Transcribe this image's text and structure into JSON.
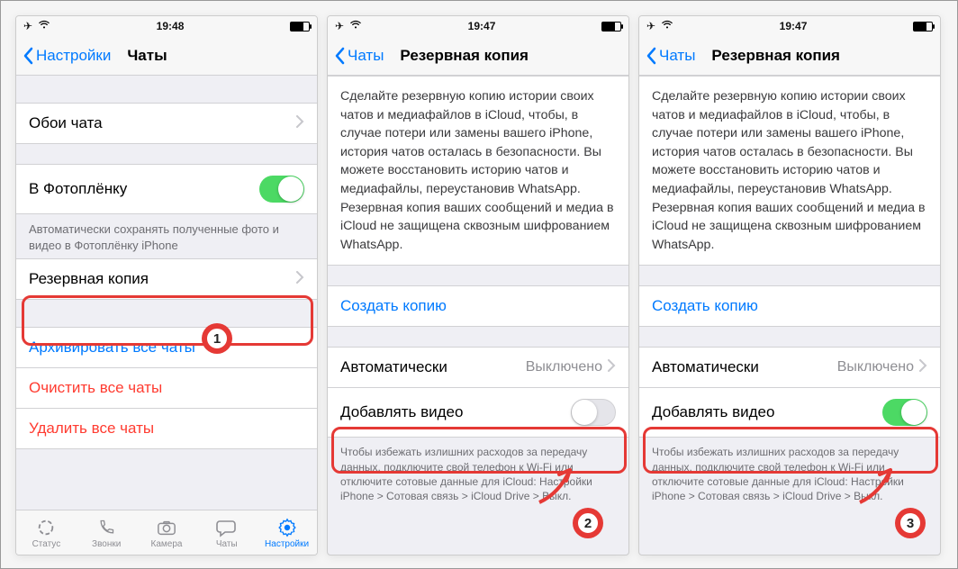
{
  "s1": {
    "status_time": "19:48",
    "back_label": "Настройки",
    "title": "Чаты",
    "wallpaper": "Обои чата",
    "save_roll": "В Фотоплёнку",
    "save_roll_on": true,
    "save_roll_note": "Автоматически сохранять полученные фото и видео в Фотоплёнку iPhone",
    "backup": "Резервная копия",
    "archive": "Архивировать все чаты",
    "clear": "Очистить все чаты",
    "delete": "Удалить все чаты",
    "tabs": {
      "status": "Статус",
      "calls": "Звонки",
      "camera": "Камера",
      "chats": "Чаты",
      "settings": "Настройки"
    },
    "badge": "1"
  },
  "s2": {
    "status_time": "19:47",
    "back_label": "Чаты",
    "title": "Резервная копия",
    "description": "Сделайте резервную копию истории своих чатов и медиафайлов в iCloud, чтобы, в случае потери или замены вашего iPhone, история чатов осталась в безопасности. Вы можете восстановить историю чатов и медиафайлы, переустановив WhatsApp. Резервная копия ваших сообщений и медиа в iCloud не защищена сквозным шифрованием WhatsApp.",
    "create": "Создать копию",
    "auto": "Автоматически",
    "auto_value": "Выключено",
    "include_video": "Добавлять видео",
    "include_video_on": false,
    "footer": "Чтобы избежать излишних расходов за передачу данных, подключите свой телефон к Wi-Fi или отключите сотовые данные для iCloud: Настройки iPhone > Сотовая связь > iCloud Drive > Выкл.",
    "badge": "2"
  },
  "s3": {
    "status_time": "19:47",
    "back_label": "Чаты",
    "title": "Резервная копия",
    "description": "Сделайте резервную копию истории своих чатов и медиафайлов в iCloud, чтобы, в случае потери или замены вашего iPhone, история чатов осталась в безопасности. Вы можете восстановить историю чатов и медиафайлы, переустановив WhatsApp. Резервная копия ваших сообщений и медиа в iCloud не защищена сквозным шифрованием WhatsApp.",
    "create": "Создать копию",
    "auto": "Автоматически",
    "auto_value": "Выключено",
    "include_video": "Добавлять видео",
    "include_video_on": true,
    "footer": "Чтобы избежать излишних расходов за передачу данных, подключите свой телефон к Wi-Fi или отключите сотовые данные для iCloud: Настройки iPhone > Сотовая связь > iCloud Drive > Выкл.",
    "badge": "3"
  }
}
